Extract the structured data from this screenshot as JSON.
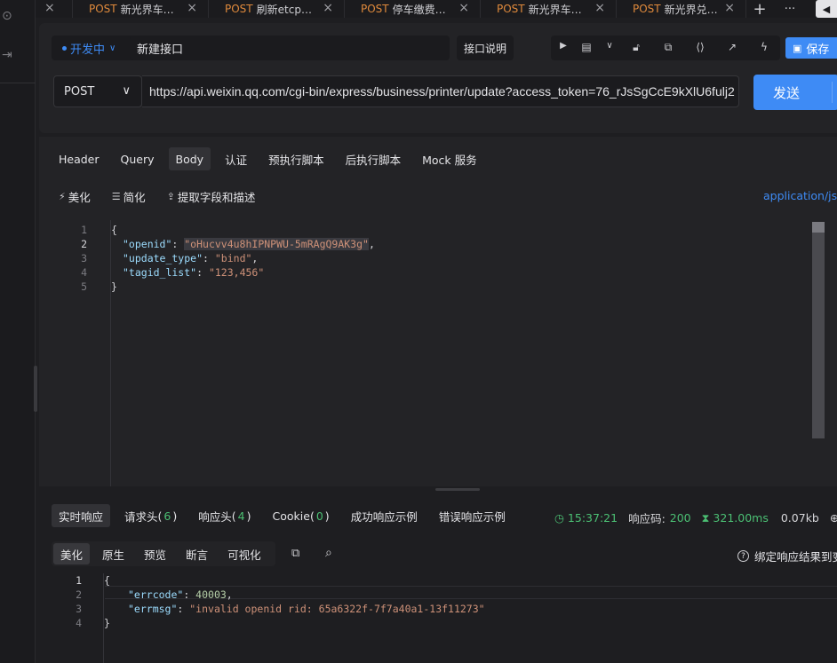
{
  "tabs": [
    {
      "method": "",
      "title": "",
      "close": "×"
    },
    {
      "method": "POST",
      "title": "新光界车…",
      "close": "×"
    },
    {
      "method": "POST",
      "title": "刷新etcp…",
      "close": "×"
    },
    {
      "method": "POST",
      "title": "停车缴费…",
      "close": "×"
    },
    {
      "method": "POST",
      "title": "新光界车…",
      "close": "×"
    },
    {
      "method": "POST",
      "title": "新光界兑…",
      "close": "×"
    }
  ],
  "tabbar": {
    "add": "+",
    "more": "···"
  },
  "request": {
    "environment": "开发中",
    "name": "新建接口",
    "doc_button": "接口说明",
    "save": "保存",
    "method": "POST",
    "url": "https://api.weixin.qq.com/cgi-bin/express/business/printer/update?access_token=76_rJsSgCcE9kXlU6fulj2",
    "send": "发送"
  },
  "body_tabs": [
    "Header",
    "Query",
    "Body",
    "认证",
    "预执行脚本",
    "后执行脚本",
    "Mock 服务"
  ],
  "body_active": "Body",
  "body_tools": {
    "beautify": "美化",
    "simplify": "简化",
    "extract": "提取字段和描述"
  },
  "content_type": "application/json",
  "request_body": {
    "line_numbers": [
      "1",
      "2",
      "3",
      "4",
      "5"
    ],
    "lines": {
      "l1": "{",
      "l2_key": "\"openid\"",
      "l2_val": "\"oHucvv4u8hIPNPWU-5mRAgQ9AK3g\"",
      "l3_key": "\"update_type\"",
      "l3_val": "\"bind\"",
      "l4_key": "\"tagid_list\"",
      "l4_val": "\"123,456\"",
      "l5": "}"
    }
  },
  "response_tabs": {
    "realtime": "实时响应",
    "req_headers": "请求头",
    "req_headers_count": "6",
    "resp_headers": "响应头",
    "resp_headers_count": "4",
    "cookie": "Cookie",
    "cookie_count": "0",
    "success_example": "成功响应示例",
    "error_example": "错误响应示例"
  },
  "response_meta": {
    "time": "15:37:21",
    "status_label": "响应码:",
    "status": "200",
    "duration": "321.00ms",
    "size": "0.07kb"
  },
  "response_view": [
    "美化",
    "原生",
    "预览",
    "断言",
    "可视化"
  ],
  "response_view_active": "美化",
  "bind_text": "绑定响应结果到变",
  "response_body": {
    "line_numbers": [
      "1",
      "2",
      "3",
      "4"
    ],
    "lines": {
      "l1": "{",
      "l2_key": "\"errcode\"",
      "l2_val": "40003",
      "l3_key": "\"errmsg\"",
      "l3_val": "\"invalid openid rid: 65a6322f-7f7a40a1-13f11273\"",
      "l4": "}"
    }
  },
  "colors": {
    "accent": "#3e8bf5",
    "method_tab": "#e08a3c",
    "success": "#4bbf73"
  }
}
